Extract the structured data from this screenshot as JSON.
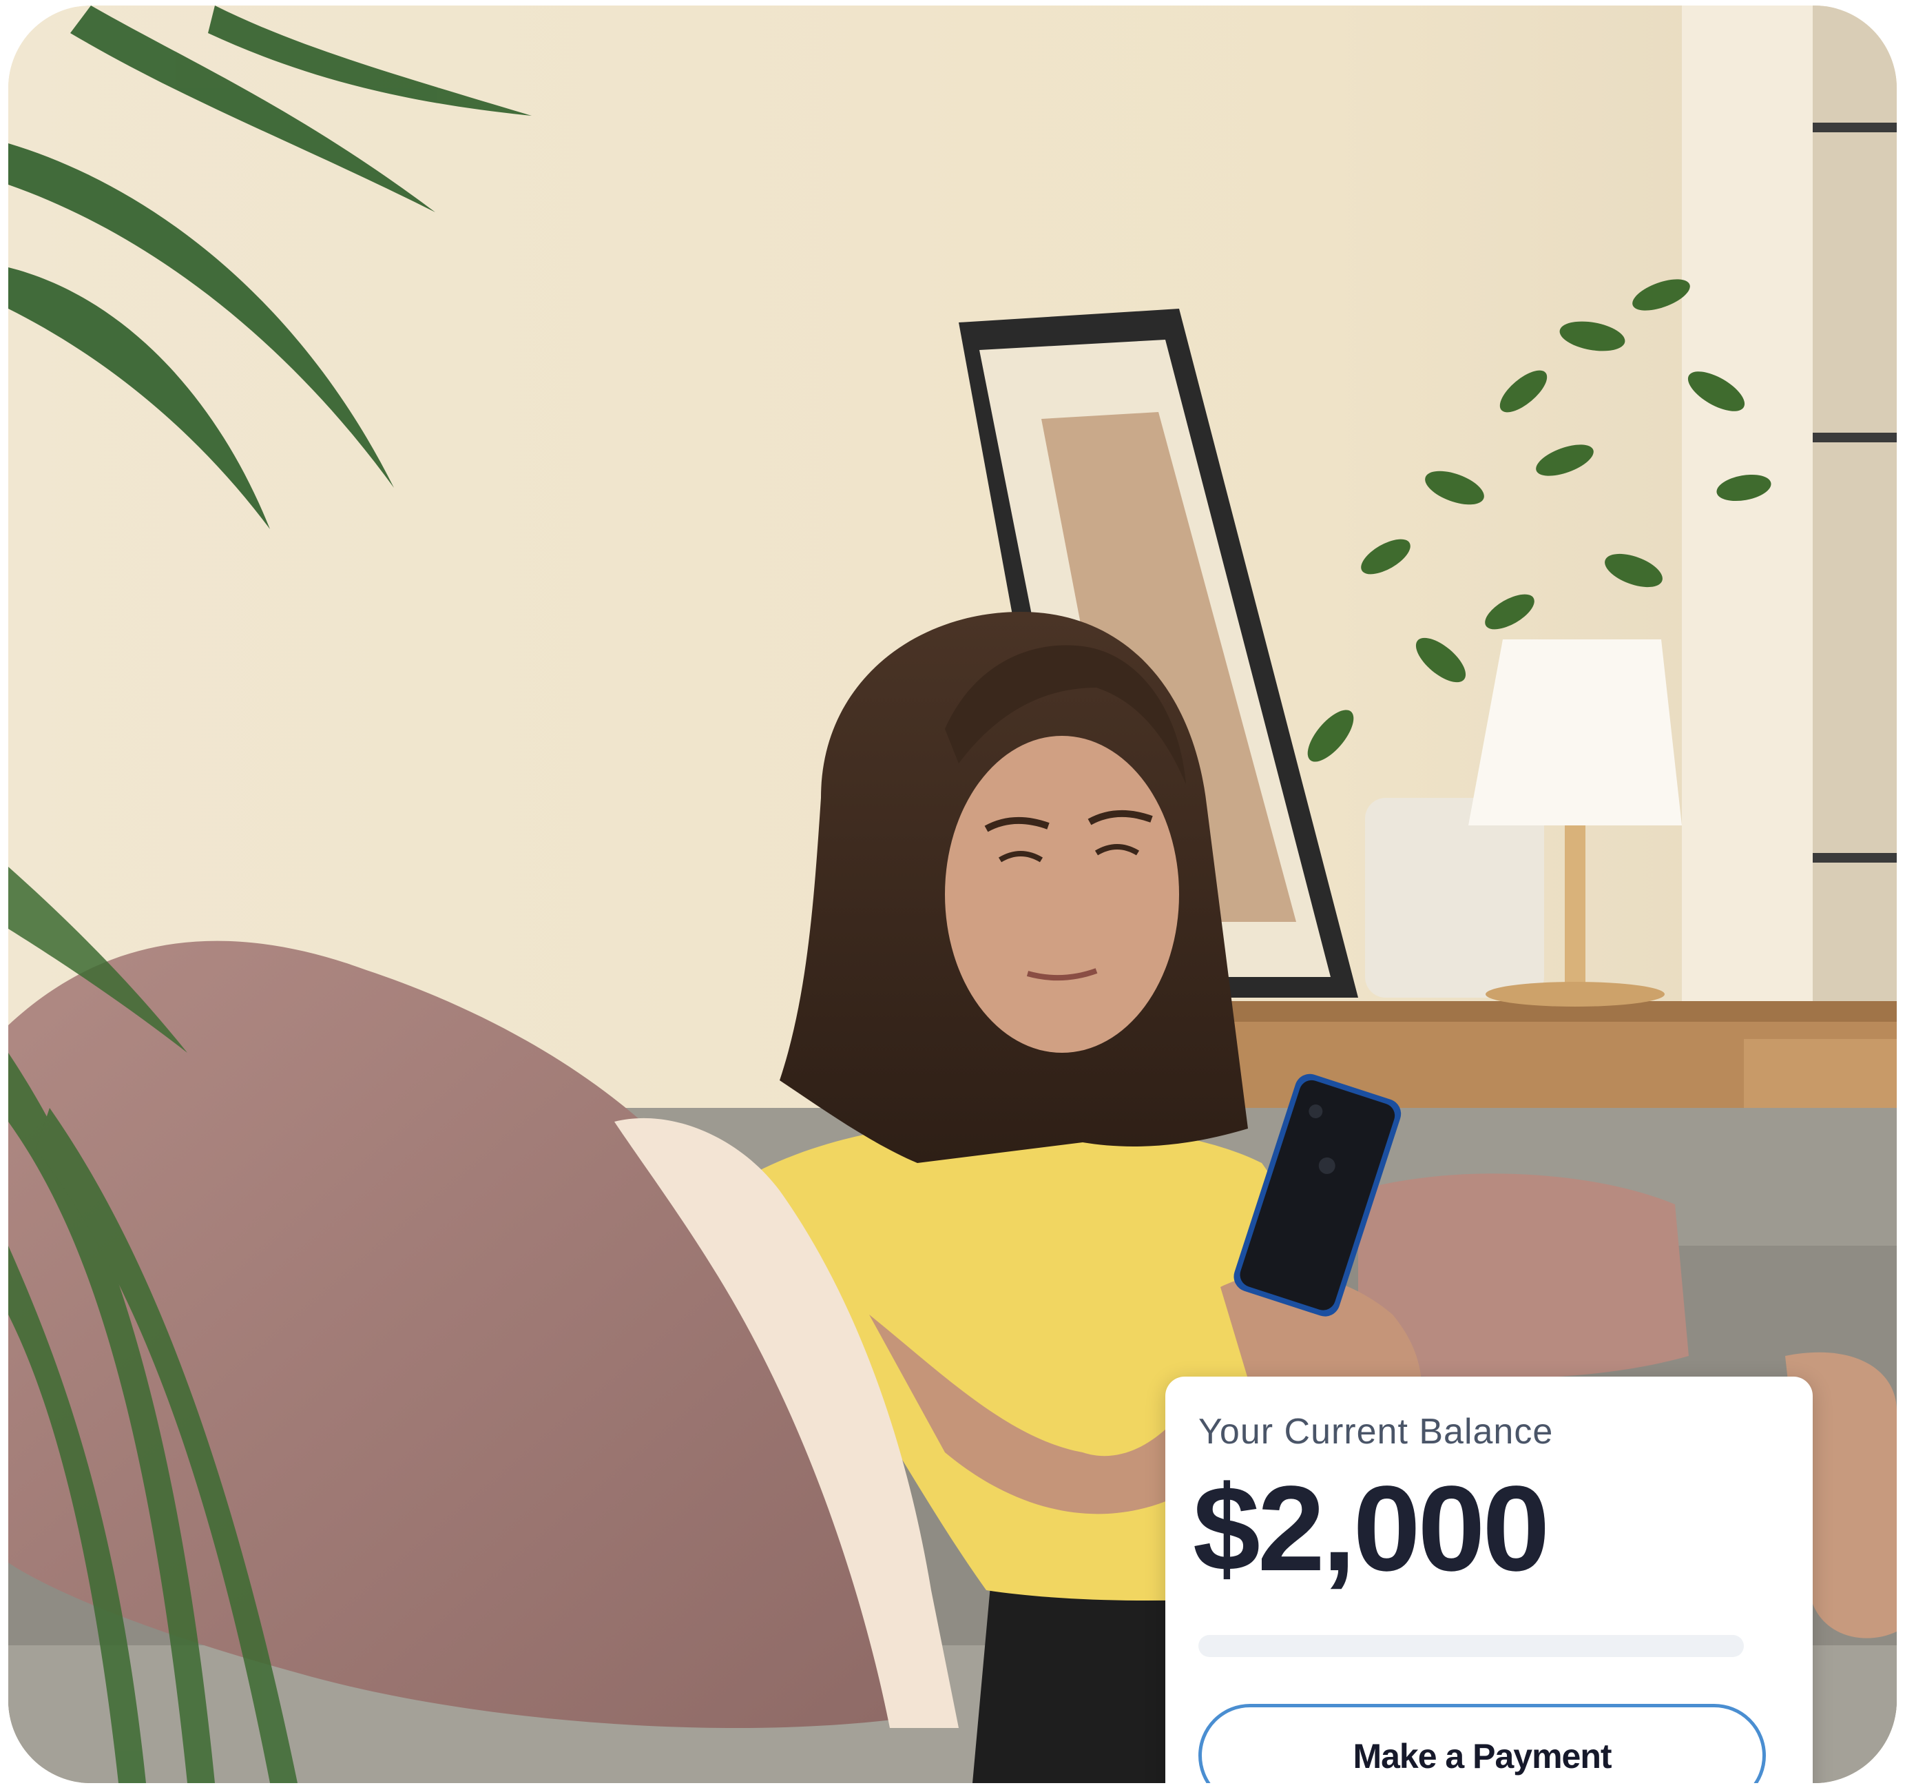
{
  "balance_card": {
    "label": "Your Current Balance",
    "amount": "$2,000",
    "progress_fraction": 0,
    "button_label": "Make a Payment"
  },
  "colors": {
    "button_border": "#4a8ed1",
    "amount_text": "#1e2233",
    "label_text": "#4a5568",
    "track": "#eef1f5"
  }
}
